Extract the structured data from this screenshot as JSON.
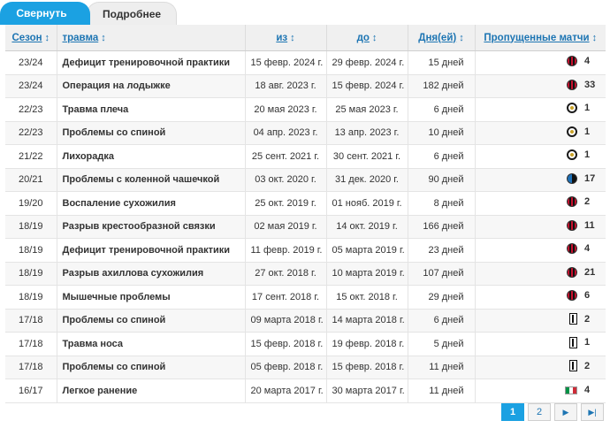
{
  "tabs": {
    "collapse": "Свернуть",
    "detail": "Подробнее"
  },
  "headers": {
    "season": "Сезон",
    "injury": "травма",
    "from": "из",
    "to": "до",
    "days": "Дня(ей)",
    "games": "Пропущенные матчи"
  },
  "rows": [
    {
      "season": "23/24",
      "injury": "Дефицит тренировочной практики",
      "from": "15 февр. 2024 г.",
      "to": "29 февр. 2024 г.",
      "days": "15 дней",
      "club_icon": "milan-crest-icon",
      "games": "4"
    },
    {
      "season": "23/24",
      "injury": "Операция на лодыжке",
      "from": "18 авг. 2023 г.",
      "to": "15 февр. 2024 г.",
      "days": "182 дней",
      "club_icon": "milan-crest-icon",
      "games": "33"
    },
    {
      "season": "22/23",
      "injury": "Травма плеча",
      "from": "20 мая 2023 г.",
      "to": "25 мая 2023 г.",
      "days": "6 дней",
      "club_icon": "spezia-crest-icon",
      "games": "1"
    },
    {
      "season": "22/23",
      "injury": "Проблемы со спиной",
      "from": "04 апр. 2023 г.",
      "to": "13 апр. 2023 г.",
      "days": "10 дней",
      "club_icon": "spezia-crest-icon",
      "games": "1"
    },
    {
      "season": "21/22",
      "injury": "Лихорадка",
      "from": "25 сент. 2021 г.",
      "to": "30 сент. 2021 г.",
      "days": "6 дней",
      "club_icon": "spezia-crest-icon",
      "games": "1"
    },
    {
      "season": "20/21",
      "injury": "Проблемы с коленной чашечкой",
      "from": "03 окт. 2020 г.",
      "to": "31 дек. 2020 г.",
      "days": "90 дней",
      "club_icon": "atalanta-crest-icon",
      "games": "17"
    },
    {
      "season": "19/20",
      "injury": "Воспаление сухожилия",
      "from": "25 окт. 2019 г.",
      "to": "01 нояб. 2019 г.",
      "days": "8 дней",
      "club_icon": "milan-crest-icon",
      "games": "2"
    },
    {
      "season": "18/19",
      "injury": "Разрыв крестообразной связки",
      "from": "02 мая 2019 г.",
      "to": "14 окт. 2019 г.",
      "days": "166 дней",
      "club_icon": "milan-crest-icon",
      "games": "11"
    },
    {
      "season": "18/19",
      "injury": "Дефицит тренировочной практики",
      "from": "11 февр. 2019 г.",
      "to": "05 марта 2019 г.",
      "days": "23 дней",
      "club_icon": "milan-crest-icon",
      "games": "4"
    },
    {
      "season": "18/19",
      "injury": "Разрыв ахиллова сухожилия",
      "from": "27 окт. 2018 г.",
      "to": "10 марта 2019 г.",
      "days": "107 дней",
      "club_icon": "milan-crest-icon",
      "games": "21"
    },
    {
      "season": "18/19",
      "injury": "Мышечные проблемы",
      "from": "17 сент. 2018 г.",
      "to": "15 окт. 2018 г.",
      "days": "29 дней",
      "club_icon": "milan-crest-icon",
      "games": "6"
    },
    {
      "season": "17/18",
      "injury": "Проблемы со спиной",
      "from": "09 марта 2018 г.",
      "to": "14 марта 2018 г.",
      "days": "6 дней",
      "club_icon": "juventus-crest-icon",
      "games": "2"
    },
    {
      "season": "17/18",
      "injury": "Травма носа",
      "from": "15 февр. 2018 г.",
      "to": "19 февр. 2018 г.",
      "days": "5 дней",
      "club_icon": "juventus-crest-icon",
      "games": "1"
    },
    {
      "season": "17/18",
      "injury": "Проблемы со спиной",
      "from": "05 февр. 2018 г.",
      "to": "15 февр. 2018 г.",
      "days": "11 дней",
      "club_icon": "juventus-crest-icon",
      "games": "2"
    },
    {
      "season": "16/17",
      "injury": "Легкое ранение",
      "from": "20 марта 2017 г.",
      "to": "30 марта 2017 г.",
      "days": "11 дней",
      "club_icon": "italy-flag-icon",
      "games": "4"
    }
  ],
  "pagination": {
    "current": "1",
    "next_page": "2",
    "next_icon": "next-page-icon",
    "last_icon": "last-page-icon"
  },
  "colors": {
    "accent": "#1ba1e2",
    "link": "#1d75b3"
  }
}
